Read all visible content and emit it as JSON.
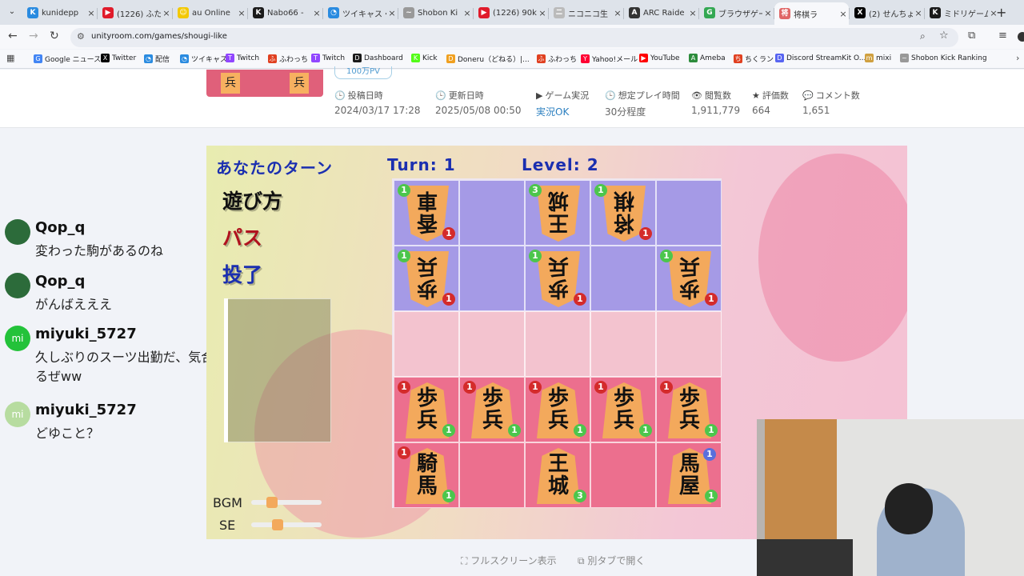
{
  "browser": {
    "tabs": [
      {
        "label": "kunidepp",
        "color": "#2a8be0",
        "icon": "K"
      },
      {
        "label": "(1226) ふた",
        "color": "#e01b2b",
        "icon": "▶"
      },
      {
        "label": "au Online",
        "color": "#f3c800",
        "icon": "☺"
      },
      {
        "label": "Nabo66 -",
        "color": "#1a1a1a",
        "icon": "K"
      },
      {
        "label": "ツイキャス・",
        "color": "#2a8be0",
        "icon": "◔"
      },
      {
        "label": "Shobon Ki",
        "color": "#999999",
        "icon": "~"
      },
      {
        "label": "(1226) 90k",
        "color": "#e01b2b",
        "icon": "▶"
      },
      {
        "label": "ニコニコ生",
        "color": "#bbbbbb",
        "icon": "ニ"
      },
      {
        "label": "ARC Raide",
        "color": "#333333",
        "icon": "A"
      },
      {
        "label": "ブラウザゲー",
        "color": "#34a853",
        "icon": "G"
      },
      {
        "label": "将棋ラ",
        "color": "#e06666",
        "icon": "将"
      },
      {
        "label": "(2) せんちょ",
        "color": "#000000",
        "icon": "X"
      },
      {
        "label": "ミドリゲーム",
        "color": "#1a1a1a",
        "icon": "K"
      }
    ],
    "active_tab_index": 10,
    "url": "unityroom.com/games/shougi-like",
    "bookmarks": [
      {
        "label": "Google ニュース",
        "color": "#4285f4",
        "icon": "G"
      },
      {
        "label": "Twitter",
        "color": "#000000",
        "icon": "X"
      },
      {
        "label": "配信",
        "color": "#2a8be0",
        "icon": "◔"
      },
      {
        "label": "ツイキャス",
        "color": "#2a8be0",
        "icon": "◔"
      },
      {
        "label": "Twitch",
        "color": "#9146ff",
        "icon": "T"
      },
      {
        "label": "ふわっち",
        "color": "#e04020",
        "icon": "ふ"
      },
      {
        "label": "Twitch",
        "color": "#9146ff",
        "icon": "T"
      },
      {
        "label": "Dashboard",
        "color": "#1a1a1a",
        "icon": "D"
      },
      {
        "label": "Kick",
        "color": "#53fc18",
        "icon": "K"
      },
      {
        "label": "Doneru（どねる）|...",
        "color": "#f0a020",
        "icon": "D"
      },
      {
        "label": "ふわっち",
        "color": "#e04020",
        "icon": "ふ"
      },
      {
        "label": "Yahoo!メール",
        "color": "#ff0033",
        "icon": "Y"
      },
      {
        "label": "YouTube",
        "color": "#ff0000",
        "icon": "▶"
      },
      {
        "label": "Ameba",
        "color": "#2d8c3c",
        "icon": "A"
      },
      {
        "label": "ちくラン",
        "color": "#e04020",
        "icon": "ち"
      },
      {
        "label": "Discord StreamKit O...",
        "color": "#5865f2",
        "icon": "D"
      },
      {
        "label": "mixi",
        "color": "#d0a040",
        "icon": "m"
      },
      {
        "label": "Shobon Kick Ranking",
        "color": "#999999",
        "icon": "~"
      }
    ]
  },
  "game_page": {
    "pv_badge": "100万PV",
    "thumb_chars": [
      "兵",
      "兵"
    ],
    "meta": [
      {
        "icon": "🕒",
        "label": "投稿日時",
        "value": "2024/03/17 17:28",
        "link": false
      },
      {
        "icon": "🕒",
        "label": "更新日時",
        "value": "2025/05/08 00:50",
        "link": false
      },
      {
        "icon": "▶",
        "label": "ゲーム実況",
        "value": "実況OK",
        "link": true
      },
      {
        "icon": "🕒",
        "label": "想定プレイ時間",
        "value": "30分程度",
        "link": false
      },
      {
        "icon": "👁",
        "label": "閲覧数",
        "value": "1,911,779",
        "link": false
      },
      {
        "icon": "★",
        "label": "評価数",
        "value": "664",
        "link": false
      },
      {
        "icon": "💬",
        "label": "コメント数",
        "value": "1,651",
        "link": false
      }
    ],
    "fullscreen_label": "フルスクリーン表示",
    "newtab_label": "別タブで開く"
  },
  "chat": [
    {
      "user": "Qop_q",
      "text": "変わった駒があるのね",
      "avatar_color": "#2c6b3a",
      "avatar_text": ""
    },
    {
      "user": "Qop_q",
      "text": "がんばえええ",
      "avatar_color": "#2c6b3a",
      "avatar_text": ""
    },
    {
      "user": "miyuki_5727",
      "text": "久しぶりのスーツ出勤だ、気合入るぜww",
      "avatar_color": "#23c23a",
      "avatar_text": "mi"
    },
    {
      "user": "miyuki_5727",
      "text": "どゆこと？",
      "avatar_color": "#b7dca0",
      "avatar_text": "mi"
    }
  ],
  "game": {
    "turn_message": "あなたのターン",
    "turn_label": "Turn: 1",
    "level_label": "Level: 2",
    "buttons": [
      {
        "label": "遊び方",
        "color": "#111111"
      },
      {
        "label": "パス",
        "color": "#b0121e"
      },
      {
        "label": "投了",
        "color": "#1b2fb0"
      }
    ],
    "bgm_label": "BGM",
    "se_label": "SE",
    "bgm_volume": 0.25,
    "se_volume": 0.35,
    "enemy_zone_color": "#a59ae6",
    "neutral_zone_color": "#f3c3cf",
    "player_zone_color": "#ec6f8e",
    "board": [
      [
        {
          "side": "enemy",
          "chars": [
            "香",
            "車"
          ],
          "top_badge": "1",
          "bottom_badge": "1"
        },
        null,
        {
          "side": "enemy",
          "chars": [
            "王",
            "城"
          ],
          "top_badge": "3",
          "bottom_badge": null
        },
        {
          "side": "enemy",
          "chars": [
            "将",
            "棋"
          ],
          "top_badge": "1",
          "bottom_badge": "1"
        },
        null
      ],
      [
        {
          "side": "enemy",
          "chars": [
            "歩",
            "兵"
          ],
          "top_badge": "1",
          "bottom_badge": "1"
        },
        null,
        {
          "side": "enemy",
          "chars": [
            "歩",
            "兵"
          ],
          "top_badge": "1",
          "bottom_badge": "1"
        },
        null,
        {
          "side": "enemy",
          "chars": [
            "歩",
            "兵"
          ],
          "top_badge": "1",
          "bottom_badge": "1"
        }
      ],
      [
        null,
        null,
        null,
        null,
        null
      ],
      [
        {
          "side": "player",
          "chars": [
            "歩",
            "兵"
          ],
          "top_badge": "1",
          "bottom_badge": "1"
        },
        {
          "side": "player",
          "chars": [
            "歩",
            "兵"
          ],
          "top_badge": "1",
          "bottom_badge": "1"
        },
        {
          "side": "player",
          "chars": [
            "歩",
            "兵"
          ],
          "top_badge": "1",
          "bottom_badge": "1"
        },
        {
          "side": "player",
          "chars": [
            "歩",
            "兵"
          ],
          "top_badge": "1",
          "bottom_badge": "1"
        },
        {
          "side": "player",
          "chars": [
            "歩",
            "兵"
          ],
          "top_badge": "1",
          "bottom_badge": "1"
        }
      ],
      [
        {
          "side": "player",
          "chars": [
            "騎",
            "馬"
          ],
          "top_badge": "1",
          "bottom_badge": "1"
        },
        null,
        {
          "side": "player",
          "chars": [
            "王",
            "城"
          ],
          "top_badge": null,
          "bottom_badge": "3"
        },
        null,
        {
          "side": "player",
          "chars": [
            "馬",
            "屋"
          ],
          "top_badge": "1",
          "bottom_badge": "1",
          "top_badge_blue": true
        }
      ]
    ]
  }
}
